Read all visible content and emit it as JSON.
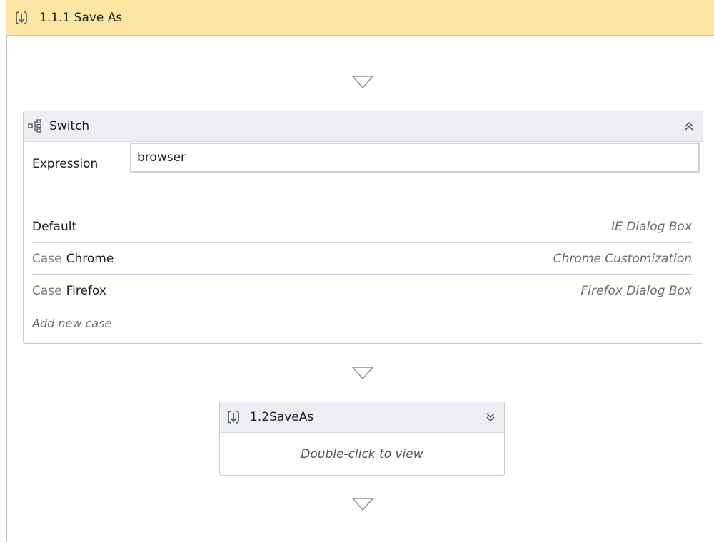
{
  "sequence": {
    "title": "1.1.1 Save As",
    "icon": "sequence-icon"
  },
  "switch": {
    "title": "Switch",
    "icon": "switch-icon",
    "expression_label": "Expression",
    "expression_value": "browser",
    "default_label": "Default",
    "default_target": "IE Dialog Box",
    "cases": [
      {
        "keyword": "Case",
        "value": "Chrome",
        "target": "Chrome Customization"
      },
      {
        "keyword": "Case",
        "value": "Firefox",
        "target": "Firefox Dialog Box"
      }
    ],
    "add_case_label": "Add new case"
  },
  "nested_sequence": {
    "title": "1.2SaveAs",
    "icon": "sequence-icon",
    "body_hint": "Double-click to view"
  },
  "colors": {
    "header_bg": "#fbe6a4",
    "activity_header_bg": "#eceef1",
    "border": "#c9c9c9"
  }
}
